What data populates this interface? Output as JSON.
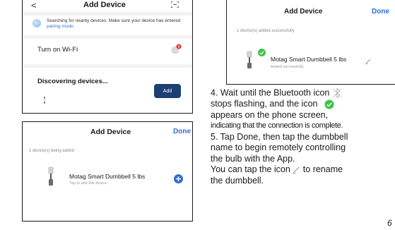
{
  "screen1": {
    "back_glyph": "<",
    "title": "Add Device",
    "scan_icon": "scan-icon",
    "search_message": "Searching for nearby devices. Make sure your device has entered",
    "search_link": "pairing mode.",
    "wifi_label": "Turn on Wi-Fi",
    "wifi_icon": "wifi-off-icon",
    "discovering_label": "Discovering devices...",
    "add_button": "Add"
  },
  "screen2": {
    "title": "Add Device",
    "done": "Done",
    "status": "1 device(s) added successfully",
    "device_name": "Motag Smart Dumbbell 5 lbs",
    "device_status": "Added successfully",
    "edit_icon": "pencil-icon"
  },
  "screen3": {
    "title": "Add Device",
    "done": "Done",
    "status": "1 device(s) being added",
    "device_name": "Motag Smart Dumbbell 5 lbs",
    "device_status": "Tap to add this device",
    "add_icon": "plus-circle-icon"
  },
  "instructions": {
    "step4_line1": "4.  Wait until the Bluetooth icon",
    "step4_line2": "stops flashing, and the icon",
    "step4_line3": " appears on the phone screen,",
    "step4_line4": "indicating that the connection is complete.",
    "step5_line1": "5. Tap Done, then tap the dumbbell",
    "step5_line2": "name to begin remotely controlling",
    "step5_line3": "the bulb with the App.",
    "rename_line1": "You can tap the icon",
    "rename_line1_end": " to rename",
    "rename_line2": "the dumbbell."
  },
  "page_number": "6",
  "colors": {
    "accent_blue": "#2f6fd6",
    "success_green": "#3fc34a",
    "add_button": "#1e3f73",
    "wifi_badge": "#e0332b"
  }
}
